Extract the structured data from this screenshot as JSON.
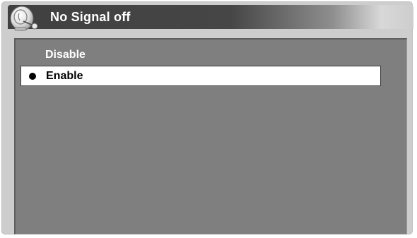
{
  "window": {
    "title": "No Signal off",
    "icon": "satellite-dish-icon"
  },
  "menu": {
    "options": [
      {
        "label": "Disable",
        "selected": false
      },
      {
        "label": "Enable",
        "selected": true
      }
    ]
  },
  "colors": {
    "title_bar": "#404040",
    "panel": "#7f7f7f",
    "highlight": "#ffffff",
    "frame": "#cdcdcd"
  }
}
